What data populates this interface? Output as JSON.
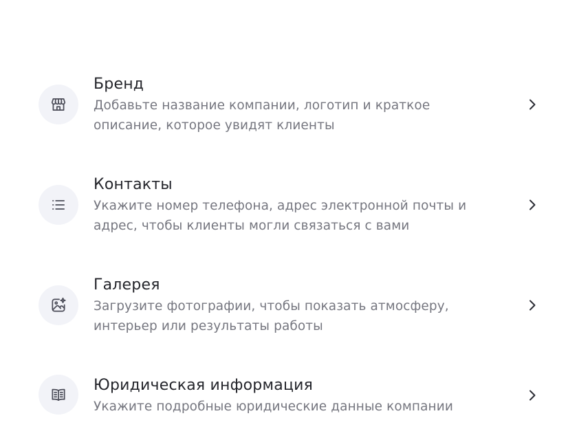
{
  "sections": [
    {
      "icon": "storefront-icon",
      "title": "Бренд",
      "description_lines": [
        "Добавьте название компании, логотип и краткое",
        "описание, которое увидят клиенты"
      ]
    },
    {
      "icon": "list-icon",
      "title": "Контакты",
      "description_lines": [
        "Укажите номер телефона, адрес электронной почты и",
        "адрес, чтобы клиенты могли связаться с вами"
      ]
    },
    {
      "icon": "image-sparkle-icon",
      "title": "Галерея",
      "description_lines": [
        "Загрузите фотографии, чтобы показать атмосферу,",
        "интерьер или результаты работы"
      ]
    },
    {
      "icon": "book-icon",
      "title": "Юридическая информация",
      "description_lines": [
        "Укажите подробные юридические данные компании"
      ]
    }
  ],
  "colors": {
    "title": "#24252b",
    "description": "#75767f",
    "icon_background": "#f2f3f8",
    "icon_stroke": "#4a4b57"
  }
}
